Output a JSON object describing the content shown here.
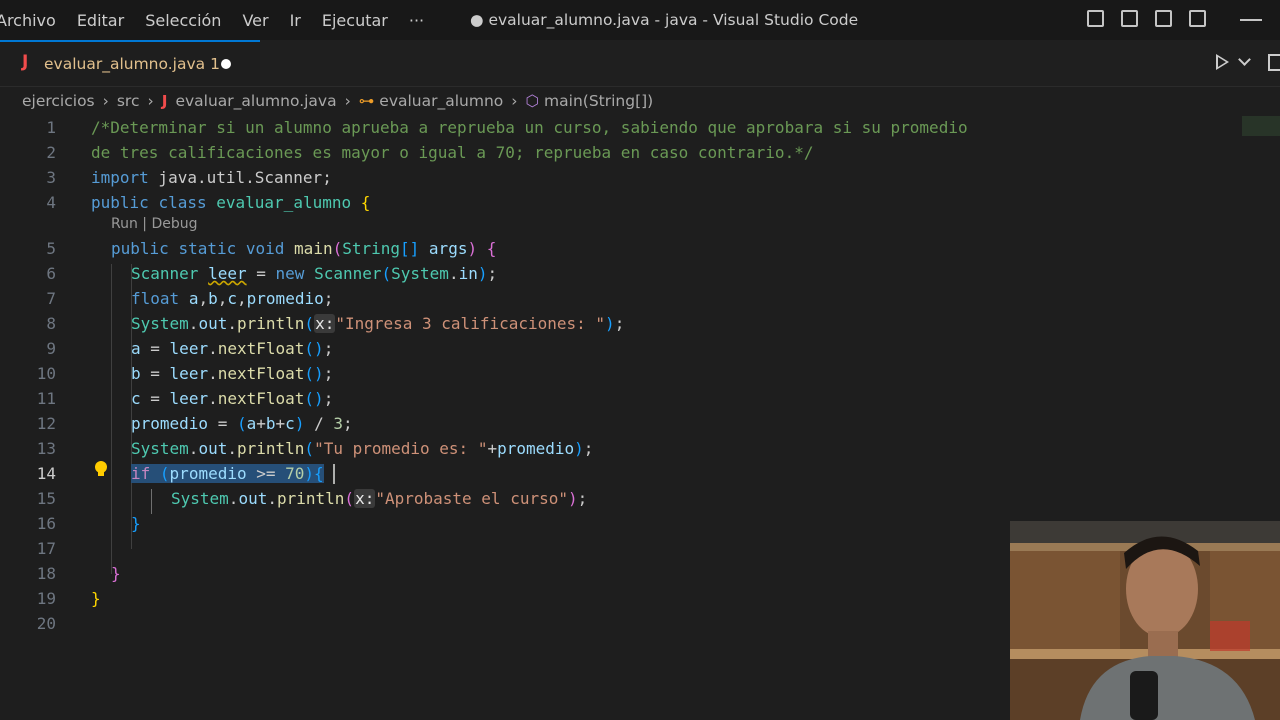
{
  "menu": [
    "Archivo",
    "Editar",
    "Selección",
    "Ver",
    "Ir",
    "Ejecutar",
    "···"
  ],
  "window_title": "● evaluar_alumno.java - java - Visual Studio Code",
  "tab": {
    "icon": "J",
    "name": "evaluar_alumno.java",
    "problems": "1"
  },
  "breadcrumb": {
    "folder": "ejercicios",
    "subfolder": "src",
    "file": "evaluar_alumno.java",
    "class": "evaluar_alumno",
    "method": "main(String[])"
  },
  "codelens": "Run | Debug",
  "line_numbers": [
    "1",
    "2",
    "3",
    "4",
    "5",
    "6",
    "7",
    "8",
    "9",
    "10",
    "11",
    "12",
    "13",
    "14",
    "15",
    "16",
    "17",
    "18",
    "19",
    "20"
  ],
  "active_line": "14",
  "code": {
    "l1": "/*Determinar si un alumno aprueba a reprueba un curso, sabiendo que aprobara si su promedio",
    "l2": "de tres calificaciones es mayor o igual a 70; reprueba en caso contrario.*/",
    "l3a": "import",
    "l3b": " java.util.Scanner;",
    "l4a": "public",
    "l4b": "class",
    "l4c": "evaluar_alumno",
    "l4d": "{",
    "l5a": "public",
    "l5b": "static",
    "l5c": "void",
    "l5d": "main",
    "l5e": "(",
    "l5f": "String",
    "l5g": "[]",
    "l5h": "args",
    "l5i": ")",
    "l5j": "{",
    "l6a": "Scanner",
    "l6b": "leer",
    "l6c": " = ",
    "l6d": "new",
    "l6e": "Scanner",
    "l6f": "(",
    "l6g": "System",
    "l6h": ".",
    "l6i": "in",
    "l6j": ")",
    "l6k": ";",
    "l7a": "float",
    "l7b": "a",
    "l7c": ",",
    "l7d": "b",
    "l7e": ",",
    "l7f": "c",
    "l7g": ",",
    "l7h": "promedio",
    "l7i": ";",
    "l8a": "System",
    "l8b": ".",
    "l8c": "out",
    "l8d": ".",
    "l8e": "println",
    "l8f": "(",
    "l8g": "x:",
    "l8h": "\"Ingresa 3 calificaciones: \"",
    "l8i": ")",
    "l8j": ";",
    "l9a": "a",
    "l9b": " = ",
    "l9c": "leer",
    "l9d": ".",
    "l9e": "nextFloat",
    "l9f": "()",
    "l9g": ";",
    "l10a": "b",
    "l10b": " = ",
    "l10c": "leer",
    "l10d": ".",
    "l10e": "nextFloat",
    "l10f": "()",
    "l10g": ";",
    "l11a": "c",
    "l11b": " = ",
    "l11c": "leer",
    "l11d": ".",
    "l11e": "nextFloat",
    "l11f": "()",
    "l11g": ";",
    "l12a": "promedio",
    "l12b": " = ",
    "l12c": "(",
    "l12d": "a",
    "l12e": "+",
    "l12f": "b",
    "l12g": "+",
    "l12h": "c",
    "l12i": ")",
    "l12j": " / ",
    "l12k": "3",
    "l12l": ";",
    "l13a": "System",
    "l13b": ".",
    "l13c": "out",
    "l13d": ".",
    "l13e": "println",
    "l13f": "(",
    "l13g": "\"Tu promedio es: \"",
    "l13h": "+",
    "l13i": "promedio",
    "l13j": ")",
    "l13k": ";",
    "l14a": "if",
    "l14b": " ",
    "l14c": "(",
    "l14d": "promedio",
    "l14e": " >= ",
    "l14f": "70",
    "l14g": ")",
    "l14h": "{",
    "l15a": "System",
    "l15b": ".",
    "l15c": "out",
    "l15d": ".",
    "l15e": "println",
    "l15f": "(",
    "l15g": "x:",
    "l15h": "\"Aprobaste el curso\"",
    "l15i": ")",
    "l15j": ";",
    "l16": "}",
    "l18": "}",
    "l19": "}"
  },
  "colors": {
    "comment": "#6a9955",
    "keyword": "#569cd6",
    "type": "#4ec9b0",
    "function": "#dcdcaa",
    "variable": "#9cdcfe",
    "string": "#ce9178",
    "number": "#b5cea8",
    "selection": "#264f78",
    "accent": "#0078d4"
  },
  "icons": [
    "toggle-primary-sidebar-icon",
    "toggle-panel-icon",
    "toggle-secondary-sidebar-icon",
    "customize-layout-icon",
    "run-icon",
    "split-editor-icon",
    "lightbulb-icon",
    "class-icon",
    "method-icon"
  ]
}
